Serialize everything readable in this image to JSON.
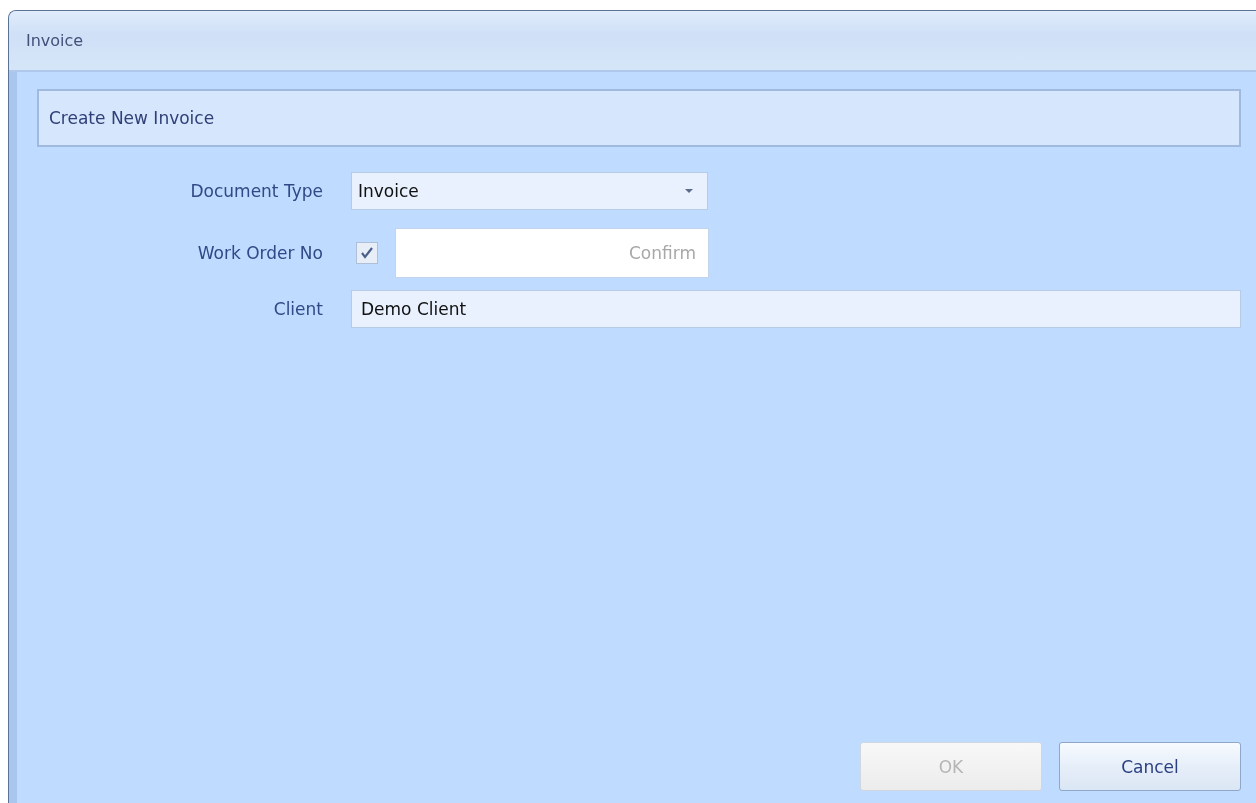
{
  "window": {
    "title": "Invoice"
  },
  "header": {
    "title": "Create New Invoice"
  },
  "fields": [
    {
      "kind": "dropdown",
      "label": "Document Type",
      "value": "Invoice"
    },
    {
      "kind": "checkfield",
      "label": "Work Order No",
      "checked": true,
      "placeholder": "Confirm"
    },
    {
      "kind": "text",
      "label": "Client",
      "value": "Demo Client"
    }
  ],
  "buttons": [
    {
      "label": "OK",
      "disabled": true
    },
    {
      "label": "Cancel",
      "disabled": false
    }
  ]
}
